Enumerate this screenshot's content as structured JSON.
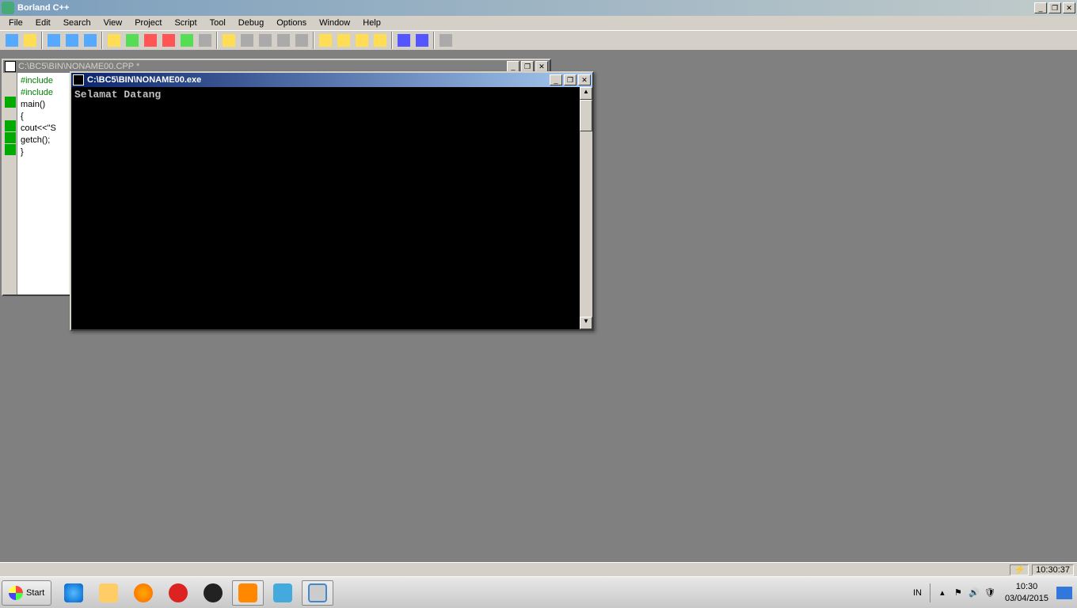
{
  "app": {
    "title": "Borland C++"
  },
  "menu": {
    "items": [
      "File",
      "Edit",
      "Search",
      "View",
      "Project",
      "Script",
      "Tool",
      "Debug",
      "Options",
      "Window",
      "Help"
    ]
  },
  "code_window": {
    "title": "C:\\BC5\\BIN\\NONAME00.CPP *",
    "lines": {
      "l0": "#include",
      "l1": "#include",
      "l2": "main()",
      "l3": "{",
      "l4": "cout<<\"S",
      "l5": "getch();",
      "l6": "}"
    }
  },
  "console": {
    "title": "C:\\BC5\\BIN\\NONAME00.exe",
    "output": "Selamat Datang"
  },
  "status": {
    "time": "10:30:37"
  },
  "taskbar": {
    "start": "Start",
    "lang": "IN",
    "clock_time": "10:30",
    "clock_date": "03/04/2015"
  }
}
